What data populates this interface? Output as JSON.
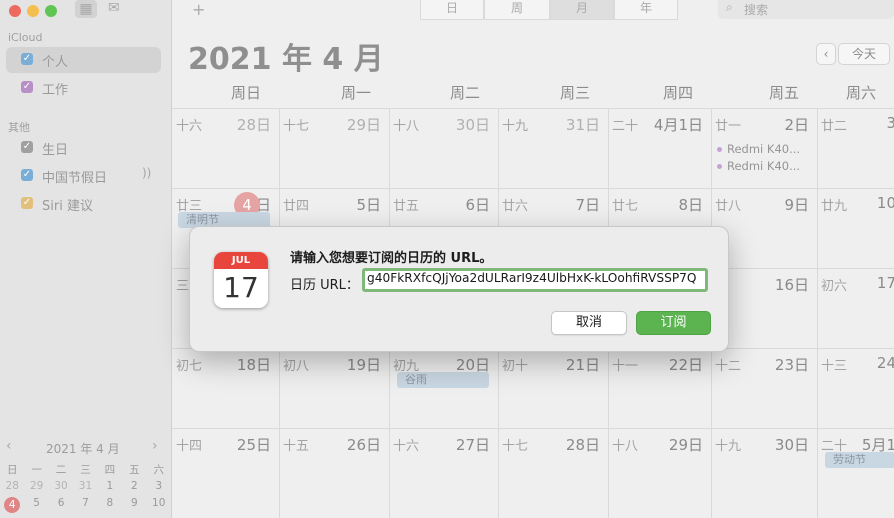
{
  "sidebar": {
    "toolbar_icons": [
      "calendar-grid-icon",
      "inbox-icon"
    ],
    "groups": [
      {
        "title": "iCloud",
        "items": [
          {
            "label": "个人",
            "color": "#7aaed6",
            "checked": true,
            "selected": true
          },
          {
            "label": "工作",
            "color": "#b88fc7",
            "checked": true,
            "selected": false
          }
        ]
      },
      {
        "title": "其他",
        "items": [
          {
            "label": "生日",
            "color": "#a0a0a0",
            "checked": true,
            "selected": false
          },
          {
            "label": "中国节假日",
            "color": "#7aaed6",
            "checked": true,
            "selected": false,
            "extra_icon": "broadcast-icon"
          },
          {
            "label": "Siri 建议",
            "color": "#e0c07a",
            "checked": true,
            "selected": false
          }
        ]
      }
    ],
    "mini_calendar": {
      "title": "2021 年 4 月",
      "weekdays": [
        "日",
        "一",
        "二",
        "三",
        "四",
        "五",
        "六"
      ],
      "rows": [
        [
          "28",
          "29",
          "30",
          "31",
          "1",
          "2",
          "3"
        ],
        [
          "4",
          "5",
          "6",
          "7",
          "8",
          "9",
          "10"
        ]
      ],
      "today": "4"
    }
  },
  "toolbar": {
    "add_label": "+",
    "views": [
      "日",
      "周",
      "月",
      "年"
    ],
    "active_view": "月",
    "search_placeholder": "搜索"
  },
  "calendar": {
    "title": "2021 年 4 月",
    "today_label": "今天",
    "prev_icon": "chevron-left-icon",
    "weekday_headers": [
      "周日",
      "周一",
      "周二",
      "周三",
      "周四",
      "周五",
      "周六"
    ],
    "weeks": [
      [
        {
          "lunar": "十六",
          "day": "28日",
          "prev": true
        },
        {
          "lunar": "十七",
          "day": "29日",
          "prev": true
        },
        {
          "lunar": "十八",
          "day": "30日",
          "prev": true
        },
        {
          "lunar": "十九",
          "day": "31日",
          "prev": true
        },
        {
          "lunar": "二十",
          "day": "4月1日"
        },
        {
          "lunar": "廿一",
          "day": "2日",
          "events": [
            "Redmi K40...",
            "Redmi K40..."
          ]
        },
        {
          "lunar": "廿二",
          "day": "3"
        }
      ],
      [
        {
          "lunar": "廿三",
          "day": "日",
          "today_number": "4",
          "bar_event": "清明节"
        },
        {
          "lunar": "廿四",
          "day": "5日"
        },
        {
          "lunar": "廿五",
          "day": "6日"
        },
        {
          "lunar": "廿六",
          "day": "7日"
        },
        {
          "lunar": "廿七",
          "day": "8日"
        },
        {
          "lunar": "廿八",
          "day": "9日"
        },
        {
          "lunar": "廿九",
          "day": "10"
        }
      ],
      [
        {
          "lunar": "三",
          "day": ""
        },
        {
          "lunar": "",
          "day": ""
        },
        {
          "lunar": "",
          "day": ""
        },
        {
          "lunar": "",
          "day": ""
        },
        {
          "lunar": "",
          "day": ""
        },
        {
          "lunar": "五",
          "day": "16日"
        },
        {
          "lunar": "初六",
          "day": "17"
        }
      ],
      [
        {
          "lunar": "初七",
          "day": "18日"
        },
        {
          "lunar": "初八",
          "day": "19日"
        },
        {
          "lunar": "初九",
          "day": "20日",
          "bar_event": "谷雨"
        },
        {
          "lunar": "初十",
          "day": "21日"
        },
        {
          "lunar": "十一",
          "day": "22日"
        },
        {
          "lunar": "十二",
          "day": "23日"
        },
        {
          "lunar": "十三",
          "day": "24"
        }
      ],
      [
        {
          "lunar": "十四",
          "day": "25日"
        },
        {
          "lunar": "十五",
          "day": "26日"
        },
        {
          "lunar": "十六",
          "day": "27日"
        },
        {
          "lunar": "十七",
          "day": "28日"
        },
        {
          "lunar": "十八",
          "day": "29日"
        },
        {
          "lunar": "十九",
          "day": "30日"
        },
        {
          "lunar": "二十",
          "day": "5月1",
          "bar_event": "劳动节"
        }
      ]
    ]
  },
  "dialog": {
    "icon_month": "JUL",
    "icon_day": "17",
    "title": "请输入您想要订阅的日历的 URL。",
    "field_label": "日历 URL：",
    "url_value": "g40FkRXfcQJjYoa2dULRarI9z4UlbHxK-kLOohfiRVSSP7Q",
    "cancel_label": "取消",
    "subscribe_label": "订阅"
  }
}
